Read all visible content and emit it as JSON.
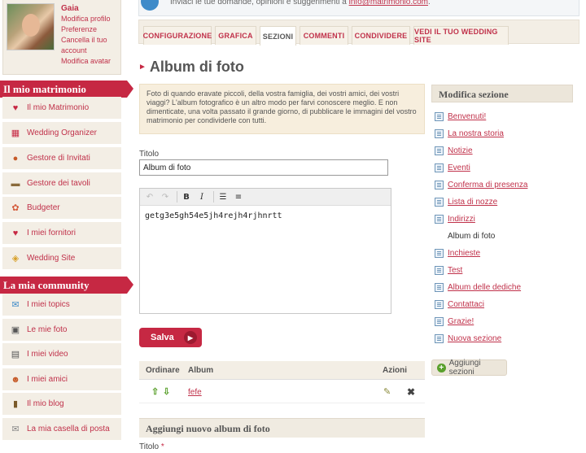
{
  "profile": {
    "name": "Gaia",
    "links": [
      "Modifica profilo",
      "Preferenze",
      "Cancella il tuo account",
      "Modifica avatar"
    ]
  },
  "sidebar": {
    "section1_title": "Il mio matrimonio",
    "section1_items": [
      {
        "label": "Il mio Matrimonio",
        "icon": "house-icon"
      },
      {
        "label": "Wedding Organizer",
        "icon": "calendar-icon"
      },
      {
        "label": "Gestore di Invitati",
        "icon": "guests-icon"
      },
      {
        "label": "Gestore dei tavoli",
        "icon": "table-icon"
      },
      {
        "label": "Budgeter",
        "icon": "budget-icon"
      },
      {
        "label": "I miei fornitori",
        "icon": "heart-icon"
      },
      {
        "label": "Wedding Site",
        "icon": "website-icon"
      }
    ],
    "section2_title": "La mia community",
    "section2_items": [
      {
        "label": "I miei topics",
        "icon": "chat-icon"
      },
      {
        "label": "Le mie foto",
        "icon": "photo-icon"
      },
      {
        "label": "I miei video",
        "icon": "video-icon"
      },
      {
        "label": "I miei amici",
        "icon": "friends-icon"
      },
      {
        "label": "Il mio blog",
        "icon": "blog-icon"
      },
      {
        "label": "La mia casella di posta",
        "icon": "mail-icon"
      }
    ]
  },
  "topbar": {
    "text": "Inviaci le tue domande, opinioni e suggerimenti a ",
    "email": "info@matrimonio.com",
    "end": "."
  },
  "tabs": [
    "CONFIGURAZIONE",
    "GRAFICA",
    "SEZIONI",
    "COMMENTI",
    "CONDIVIDERE",
    "VEDI IL TUO WEDDING SITE"
  ],
  "active_tab": "SEZIONI",
  "page_title": "Album di foto",
  "description": "Foto di quando eravate piccoli, della vostra famiglia, dei vostri amici, dei vostri viaggi? L'album fotografico è un altro modo per farvi conoscere meglio. E non dimenticate, una volta passato il grande giorno, di pubblicare le immagini del vostro matrimonio per condividerle con tutti.",
  "form": {
    "titolo_label": "Titolo",
    "titolo_value": "Album di foto",
    "editor_content": "getg3e5gh54e5jh4rejh4rjhnrtt",
    "save_label": "Salva"
  },
  "album_table": {
    "headers": [
      "Ordinare",
      "Album",
      "Azioni"
    ],
    "rows": [
      {
        "album": "fefe"
      }
    ]
  },
  "add_album": {
    "title": "Aggiungi nuovo album di foto",
    "titolo_label": "Titolo",
    "required_mark": "*"
  },
  "right_sidebar": {
    "title": "Modifica sezione",
    "items": [
      "Benvenuti!",
      "La nostra storia",
      "Notizie",
      "Eventi",
      "Conferma di presenza",
      "Lista di nozze",
      "Indirizzi",
      "Album di foto",
      "Inchieste",
      "Test",
      "Album delle dediche",
      "Contattaci",
      "Grazie!",
      "Nuova sezione"
    ],
    "current": "Album di foto",
    "add_label": "Aggiungi sezioni"
  },
  "colors": {
    "accent": "#c62843",
    "link": "#c0314a",
    "panel": "#f3eee5"
  }
}
